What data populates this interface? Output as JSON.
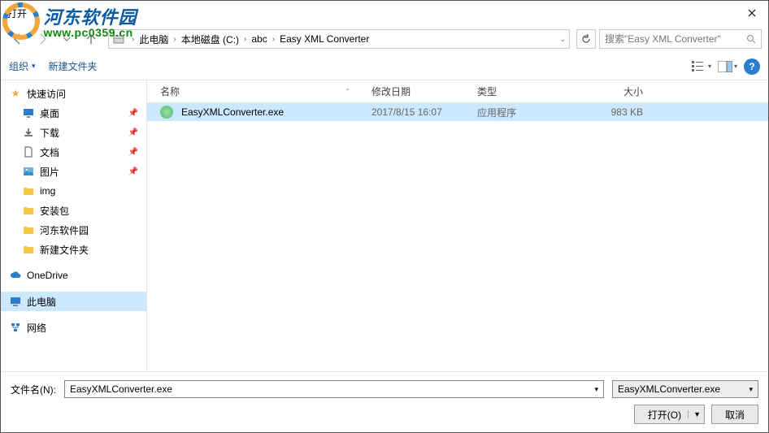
{
  "title": "打开",
  "watermark": {
    "title": "河东软件园",
    "url": "www.pc0359.cn"
  },
  "nav": {
    "breadcrumb": [
      "此电脑",
      "本地磁盘 (C:)",
      "abc",
      "Easy XML Converter"
    ],
    "search_placeholder": "搜索\"Easy XML Converter\""
  },
  "toolbar": {
    "organize": "组织",
    "new_folder": "新建文件夹"
  },
  "sidebar": {
    "quick_access": "快速访问",
    "items": [
      {
        "label": "桌面",
        "icon": "desktop",
        "pinned": true
      },
      {
        "label": "下载",
        "icon": "download",
        "pinned": true
      },
      {
        "label": "文档",
        "icon": "document",
        "pinned": true
      },
      {
        "label": "图片",
        "icon": "picture",
        "pinned": true
      },
      {
        "label": "img",
        "icon": "folder",
        "pinned": false
      },
      {
        "label": "安装包",
        "icon": "folder",
        "pinned": false
      },
      {
        "label": "河东软件园",
        "icon": "folder",
        "pinned": false
      },
      {
        "label": "新建文件夹",
        "icon": "folder",
        "pinned": false
      }
    ],
    "onedrive": "OneDrive",
    "this_pc": "此电脑",
    "network": "网络"
  },
  "columns": {
    "name": "名称",
    "date": "修改日期",
    "type": "类型",
    "size": "大小"
  },
  "files": [
    {
      "name": "EasyXMLConverter.exe",
      "date": "2017/8/15 16:07",
      "type": "应用程序",
      "size": "983 KB",
      "selected": true
    }
  ],
  "bottom": {
    "filename_label": "文件名(N):",
    "filename_value": "EasyXMLConverter.exe",
    "filter": "EasyXMLConverter.exe",
    "open": "打开(O)",
    "cancel": "取消"
  }
}
